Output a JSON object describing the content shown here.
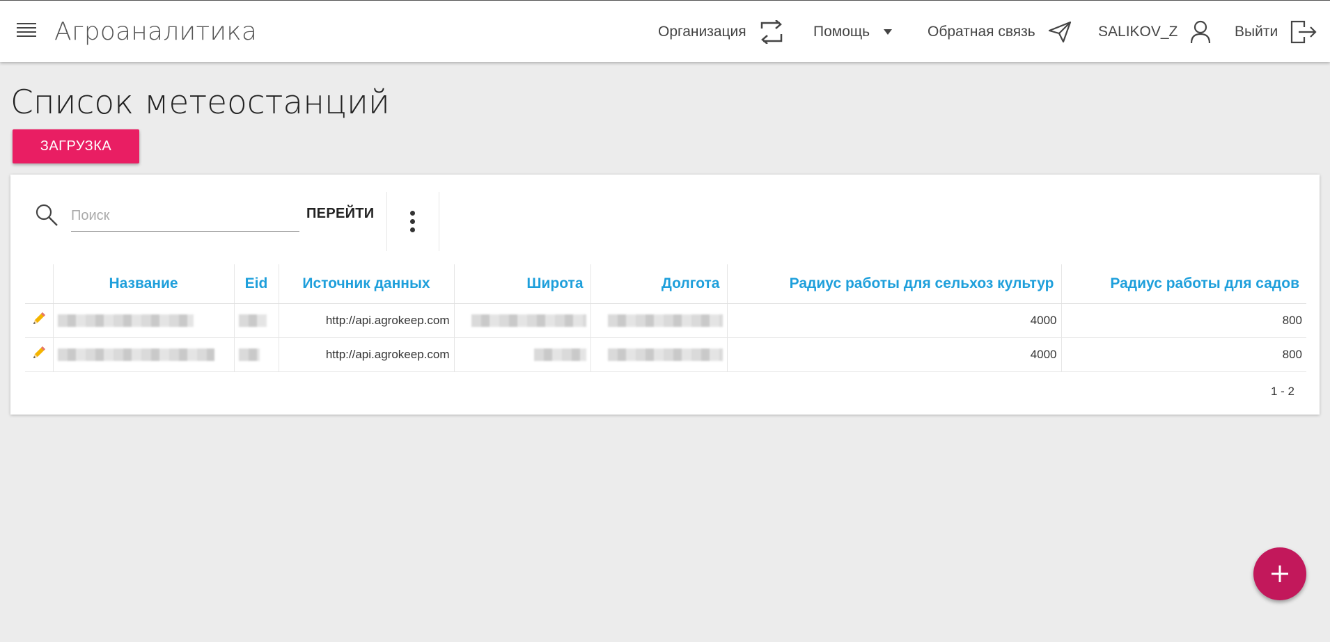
{
  "header": {
    "app_title": "Агроаналитика",
    "nav": {
      "organization": "Организация",
      "help": "Помощь",
      "feedback": "Обратная связь",
      "user": "SALIKOV_Z",
      "logout": "Выйти"
    },
    "icons": [
      "menu-icon",
      "swap-icon",
      "caret-down-icon",
      "send-icon",
      "user-icon",
      "logout-icon"
    ]
  },
  "page": {
    "title": "Список метеостанций",
    "upload_label": "ЗАГРУЗКА"
  },
  "toolbar": {
    "search_placeholder": "Поиск",
    "go_label": "ПЕРЕЙТИ"
  },
  "table": {
    "columns": [
      "Название",
      "Eid",
      "Источник данных",
      "Широта",
      "Долгота",
      "Радиус работы для сельхоз культур",
      "Радиус работы для садов"
    ],
    "rows": [
      {
        "source": "http://api.agrokeep.com",
        "radius_crops": "4000",
        "radius_gardens": "800"
      },
      {
        "source": "http://api.agrokeep.com",
        "radius_crops": "4000",
        "radius_gardens": "800"
      }
    ]
  },
  "pagination": "1 - 2",
  "colors": {
    "accent": "#e91e63",
    "fab": "#c2185b",
    "header_text": "#1e9fdb"
  }
}
